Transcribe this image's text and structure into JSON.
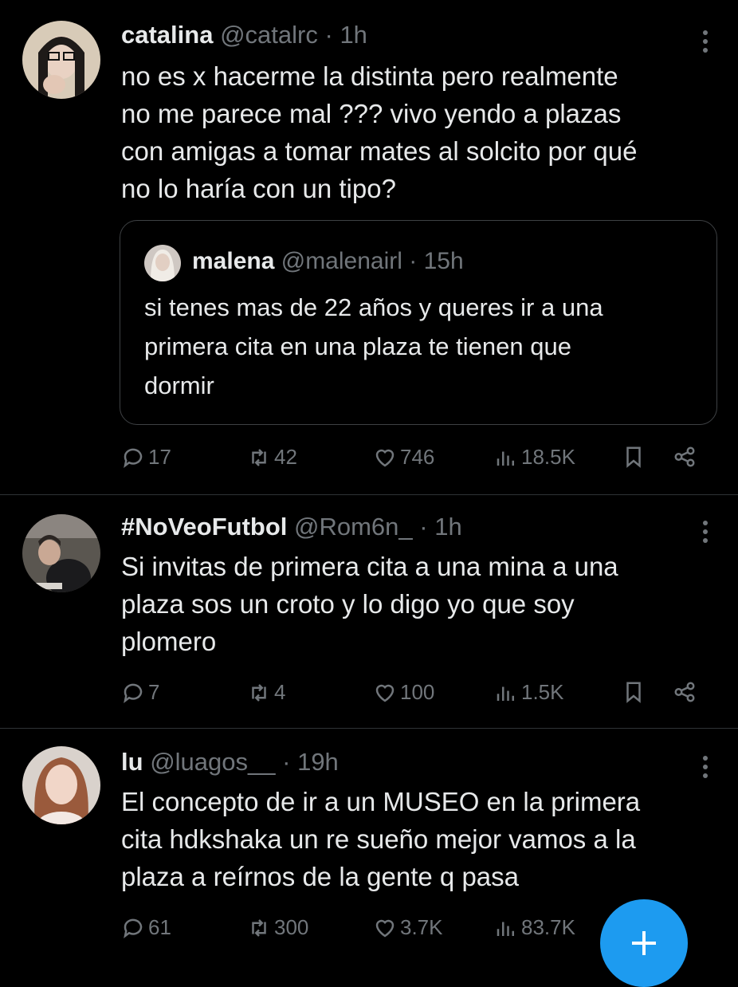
{
  "tweets": [
    {
      "name": "catalina",
      "handle": "@catalrc",
      "dot": "·",
      "time": "1h",
      "text": "no es x hacerme la distinta pero realmente\nno me parece mal ??? vivo yendo a plazas\ncon amigas a tomar mates al solcito por qué\nno lo haría con un tipo?",
      "quote": {
        "name": "malena",
        "handle": "@malenairl",
        "dot": "·",
        "time": "15h",
        "text": "si tenes mas de 22 años y queres ir a una\nprimera cita en una plaza te tienen que\ndormir"
      },
      "replies": "17",
      "retweets": "42",
      "likes": "746",
      "views": "18.5K"
    },
    {
      "name": "#NoVeoFutbol",
      "handle": "@Rom6n_",
      "dot": "·",
      "time": "1h",
      "text": "Si invitas de primera cita a una mina a una\nplaza sos un croto y lo digo yo que soy\nplomero",
      "replies": "7",
      "retweets": "4",
      "likes": "100",
      "views": "1.5K"
    },
    {
      "name": "lu",
      "handle": "@luagos__",
      "dot": "·",
      "time": "19h",
      "text": "El concepto de ir a un MUSEO en la primera\ncita hdkshaka un re sueño mejor vamos a la\nplaza a reírnos de la gente q pasa",
      "replies": "61",
      "retweets": "300",
      "likes": "3.7K",
      "views": "83.7K"
    }
  ],
  "icons": {
    "reply": "speech-bubble-icon",
    "retweet": "retweet-arrows-icon",
    "like": "heart-icon",
    "views": "bar-chart-icon",
    "bookmark": "bookmark-icon",
    "share": "share-nodes-icon",
    "more": "vertical-dots-icon",
    "compose": "plus-icon"
  },
  "colors": {
    "background": "#000000",
    "text": "#e7e9ea",
    "muted": "#71767b",
    "divider": "#2f3336",
    "accent": "#1d9bf0"
  }
}
